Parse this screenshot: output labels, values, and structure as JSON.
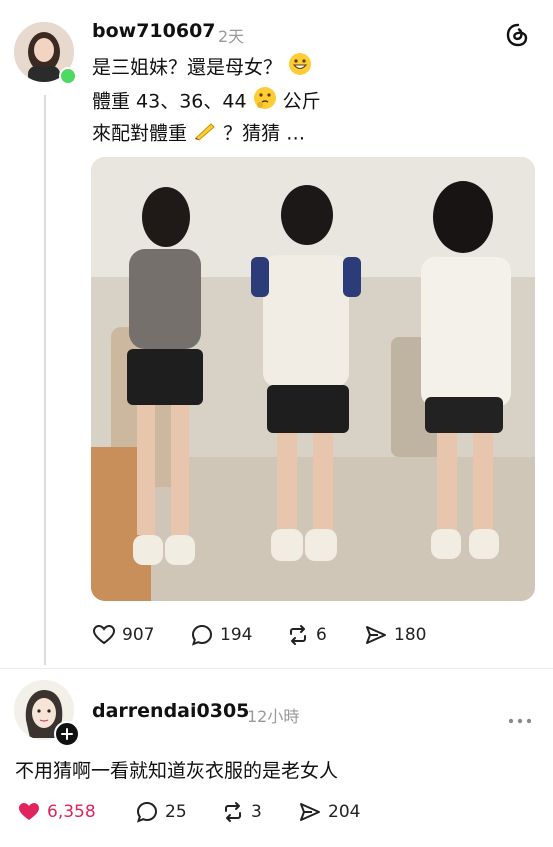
{
  "post": {
    "username": "bow710607",
    "time": "2天",
    "lines": [
      "是三姐妹？還是母女？",
      "體重 43、36、44",
      "公斤",
      "來配對體重",
      "？猜猜 …"
    ],
    "likes": "907",
    "comments": "194",
    "reposts": "6",
    "shares": "180"
  },
  "reply": {
    "username": "darrendai0305",
    "time": "12小時",
    "text": "不用猜啊一看就知道灰衣服的是老女人",
    "likes": "6,358",
    "comments": "25",
    "reposts": "3",
    "shares": "204"
  },
  "colors": {
    "like_active": "#e0245e",
    "online": "#4cd964"
  }
}
